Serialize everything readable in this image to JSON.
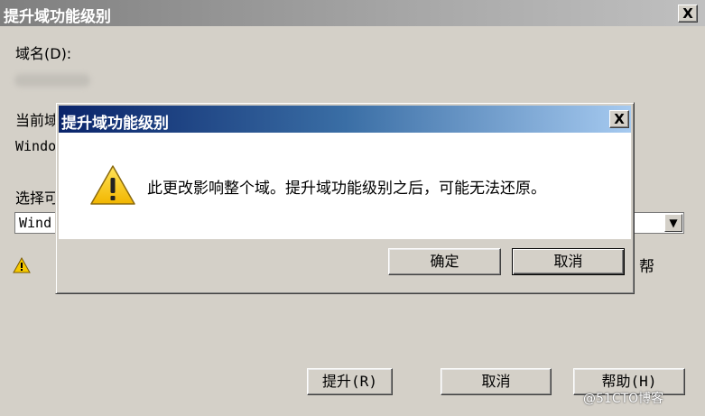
{
  "outer_dialog": {
    "title": "提升域功能级别",
    "close_label": "X",
    "domain_name_label": "域名(D):",
    "current_level_label": "当前域",
    "current_level_value": "Windo",
    "select_level_label": "选择可",
    "select_value": "Wind",
    "help_fragment": "帮",
    "buttons": {
      "raise": "提升(R)",
      "cancel": "取消",
      "help": "帮助(H)"
    }
  },
  "modal": {
    "title": "提升域功能级别",
    "close_label": "X",
    "message": "此更改影响整个域。提升域功能级别之后，可能无法还原。",
    "buttons": {
      "ok": "确定",
      "cancel": "取消"
    }
  },
  "icons": {
    "warning_small": "warning-icon",
    "warning_large": "warning-icon",
    "dropdown": "chevron-down-icon"
  },
  "watermark": "@51CTO博客"
}
